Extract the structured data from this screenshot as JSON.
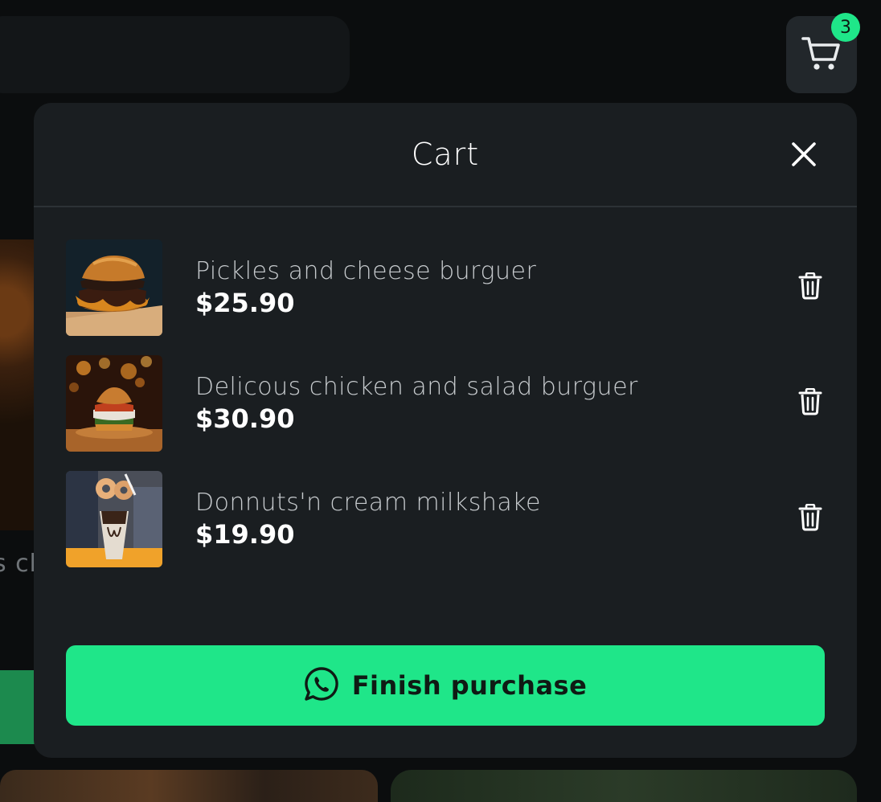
{
  "cart_button": {
    "badge_count": "3",
    "icon": "cart-icon"
  },
  "modal": {
    "title": "Cart",
    "close_icon": "close-icon",
    "items": [
      {
        "name": "Pickles and cheese burguer",
        "price": "$25.90"
      },
      {
        "name": "Delicous chicken and salad burguer",
        "price": "$30.90"
      },
      {
        "name": "Donnuts'n cream milkshake",
        "price": "$19.90"
      }
    ],
    "delete_icon": "trash-icon",
    "finish_button": {
      "label": "Finish purchase",
      "icon": "whatsapp-icon"
    }
  },
  "background": {
    "partial_text": "s ch"
  },
  "colors": {
    "accent": "#1fe689",
    "modal_bg": "#1a1e21",
    "page_bg": "#0b0d0e"
  }
}
